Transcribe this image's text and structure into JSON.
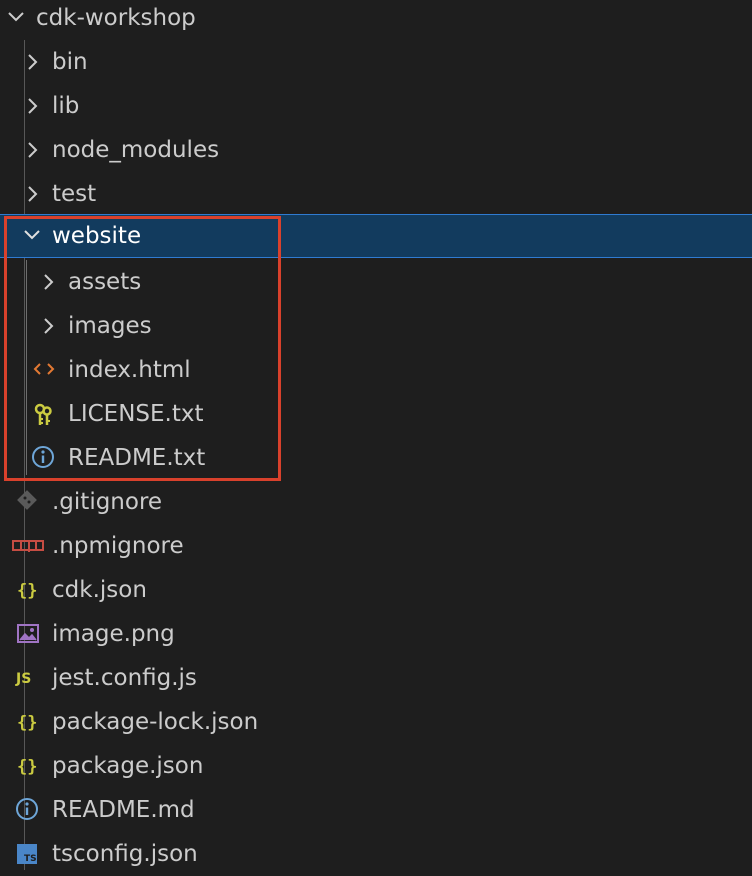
{
  "explorer": {
    "root": {
      "label": "cdk-workshop",
      "expanded": true
    },
    "folders": {
      "bin": "bin",
      "lib": "lib",
      "node_modules": "node_modules",
      "test": "test",
      "website": "website"
    },
    "website_children": {
      "assets": "assets",
      "images": "images",
      "index_html": "index.html",
      "license": "LICENSE.txt",
      "readme_txt": "README.txt"
    },
    "root_files": {
      "gitignore": ".gitignore",
      "npmignore": ".npmignore",
      "cdk_json": "cdk.json",
      "image_png": "image.png",
      "jest_config": "jest.config.js",
      "package_lock": "package-lock.json",
      "package_json": "package.json",
      "readme_md": "README.md",
      "tsconfig": "tsconfig.json"
    },
    "selected_item": "website",
    "highlight_color": "#d9412c",
    "selection_color": "#123b5e"
  },
  "icons": {
    "folder_collapsed": "chevron-right-icon",
    "folder_expanded": "chevron-down-icon",
    "html": "html-code-icon",
    "license": "key-icon",
    "readme": "info-icon",
    "gitignore": "git-icon",
    "npmignore": "npm-icon",
    "json": "json-braces-icon",
    "image": "image-icon",
    "javascript": "javascript-icon",
    "typescript": "typescript-icon"
  }
}
